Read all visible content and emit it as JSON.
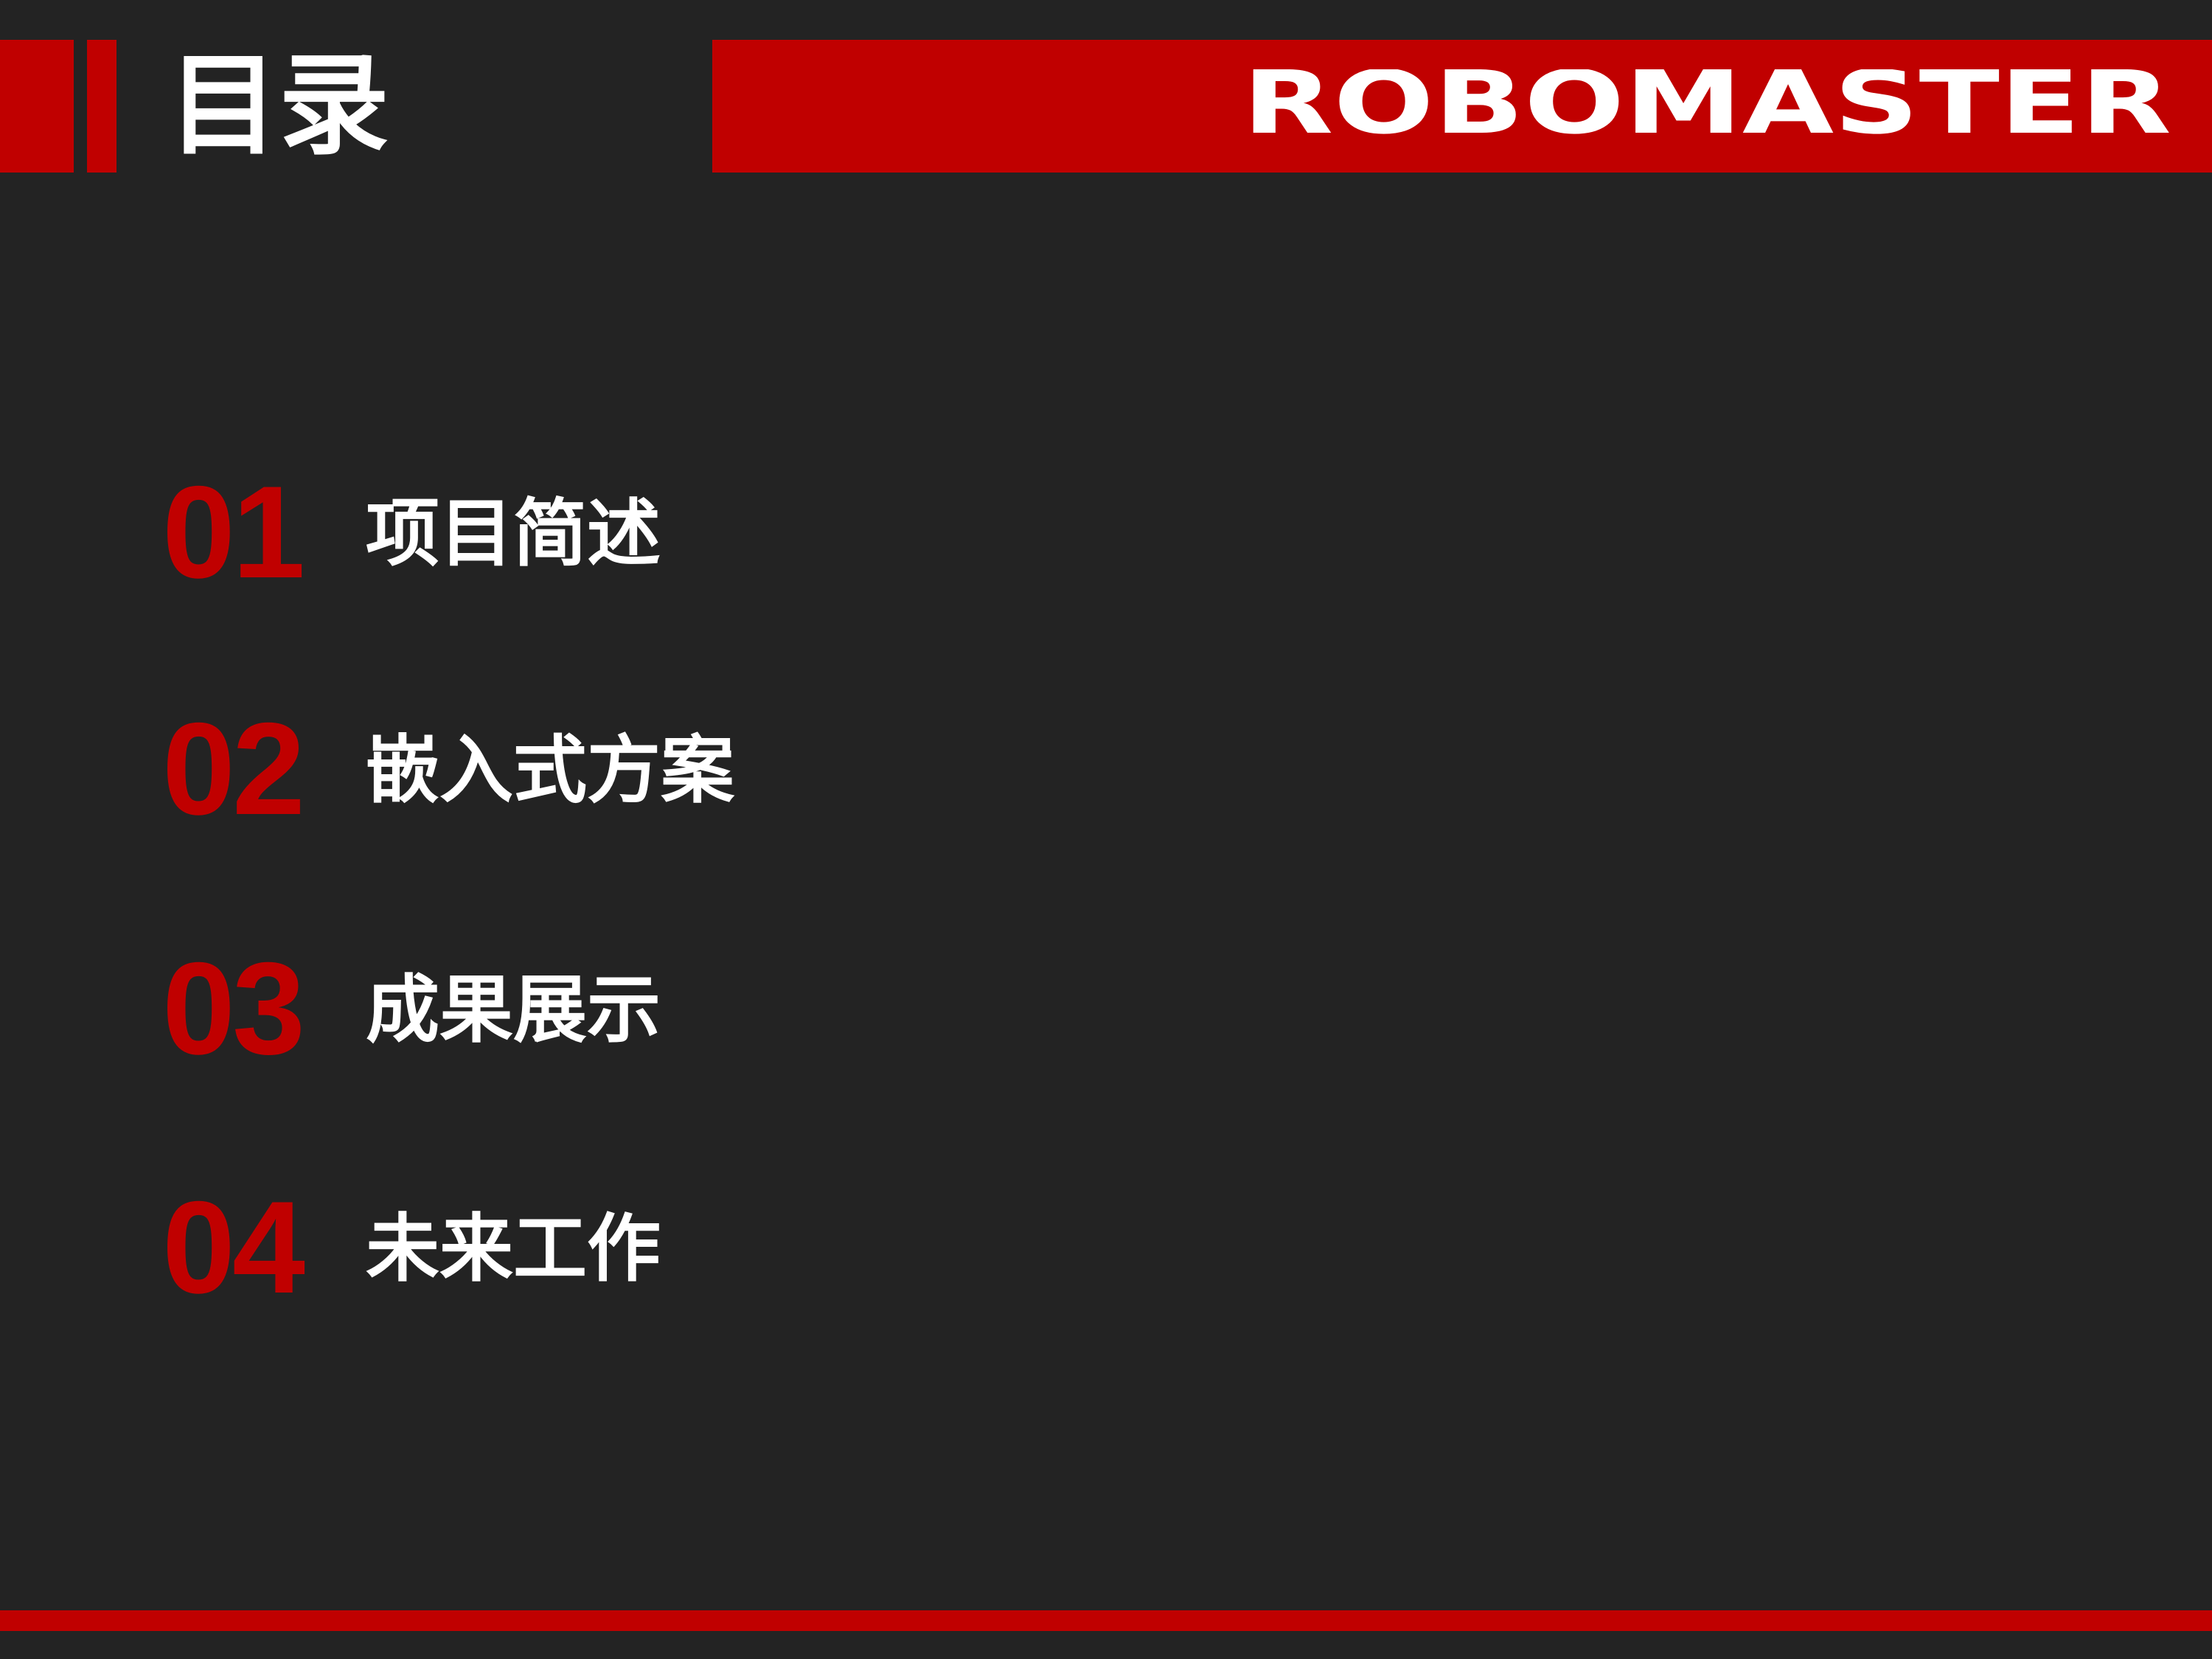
{
  "header": {
    "title": "目录",
    "brand": "ROBOMASTER"
  },
  "agenda": {
    "items": [
      {
        "number": "01",
        "label": "项目简述"
      },
      {
        "number": "02",
        "label": "嵌入式方案"
      },
      {
        "number": "03",
        "label": "成果展示"
      },
      {
        "number": "04",
        "label": "未来工作"
      }
    ]
  },
  "colors": {
    "background": "#232323",
    "accent": "#c00000",
    "text": "#ffffff"
  }
}
